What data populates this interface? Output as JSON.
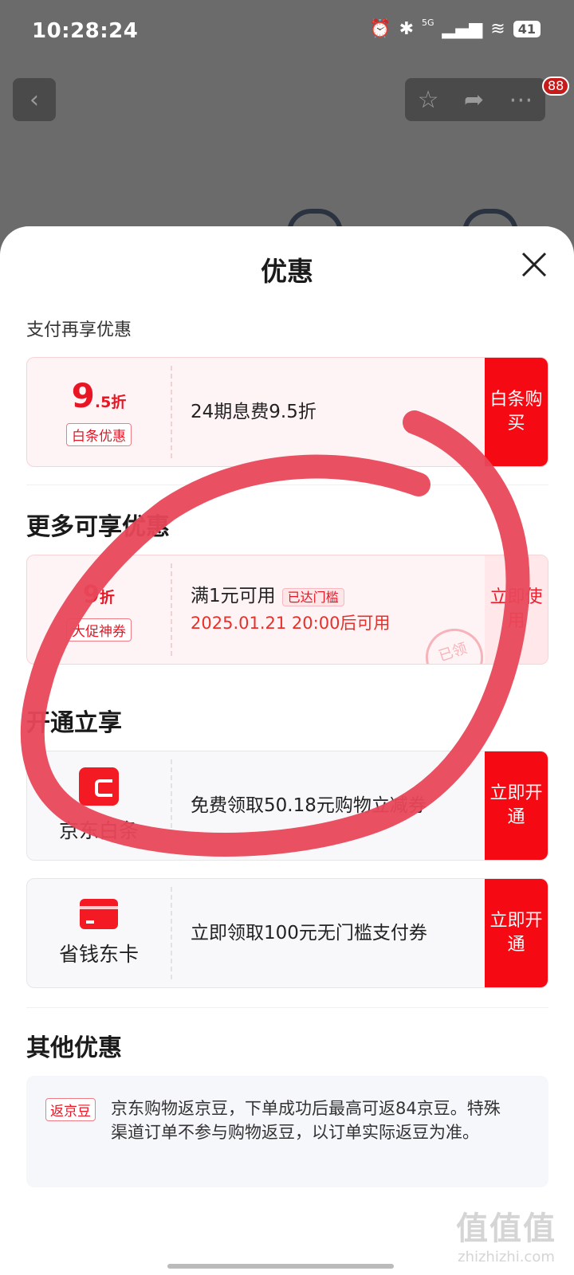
{
  "status_bar": {
    "time": "10:28:24",
    "network": "5G",
    "battery": "41"
  },
  "top_nav": {
    "badge": "88"
  },
  "sheet": {
    "title": "优惠"
  },
  "sections": {
    "pay": {
      "label": "支付再享优惠",
      "card": {
        "discount_num": "9",
        "discount_suffix": ".5折",
        "tag": "白条优惠",
        "text": "24期息费9.5折",
        "button": "白条购买"
      }
    },
    "more": {
      "title": "更多可享优惠",
      "card": {
        "discount_num": "9",
        "discount_suffix": "折",
        "tag": "大促神券",
        "condition": "满1元可用",
        "condition_tag": "已达门槛",
        "date": "2025.01.21 20:00后可用",
        "button": "立即使用",
        "stamp": "已领"
      }
    },
    "open": {
      "title": "开通立享",
      "cards": [
        {
          "name": "京东白条",
          "icon": "wallet-icon",
          "text": "免费领取50.18元购物立减券",
          "button": "立即开通"
        },
        {
          "name": "省钱东卡",
          "icon": "card-icon",
          "text": "立即领取100元无门槛支付券",
          "button": "立即开通"
        }
      ]
    },
    "other": {
      "title": "其他优惠",
      "tag": "返京豆",
      "text": "京东购物返京豆，下单成功后最高可返84京豆。特殊渠道订单不参与购物返豆，以订单实际返豆为准。"
    }
  },
  "watermark": {
    "logo": "值值值",
    "site": "zhizhizhi.com"
  },
  "colors": {
    "accent": "#f50a14",
    "annotation": "#e8485a",
    "sheet_bg": "#ffffff",
    "backdrop": "#6b6b6b"
  }
}
